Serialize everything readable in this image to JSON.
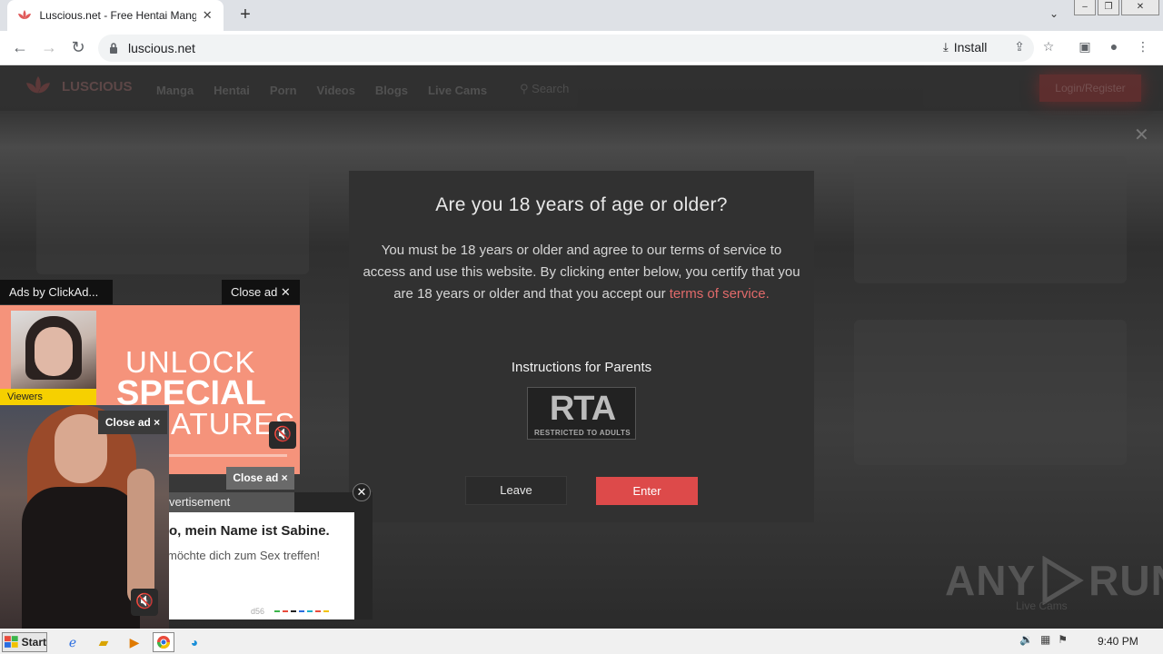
{
  "browser": {
    "tab_title": "Luscious.net - Free Hentai Manga, D",
    "url": "luscious.net",
    "install_label": "Install"
  },
  "site": {
    "logo": "LUSCIOUS",
    "nav": [
      "Manga",
      "Hentai",
      "Porn",
      "Videos",
      "Blogs",
      "Live Cams"
    ],
    "search_placeholder": "Search",
    "login_label": "Login/Register"
  },
  "modal": {
    "title": "Are you 18 years of age or older?",
    "body": "You must be 18 years or older and agree to our terms of service to access and use this website. By clicking enter below, you certify that you are 18 years or older and that you accept our",
    "link": "terms of service.",
    "parents": "Instructions for Parents",
    "rta_logo": "RTA",
    "rta_sub": "RESTRICTED TO ADULTS",
    "leave_label": "Leave",
    "enter_label": "Enter"
  },
  "ads": {
    "label": "Ads by ClickAd...",
    "close1": "Close ad ✕",
    "viewers": "Viewers",
    "unlock_line1": "UNLOCK",
    "unlock_line2": "SPECIAL",
    "unlock_line3": "ATURES",
    "close_small": "Close ad ×",
    "close2": "Close ad ×",
    "advertisement": "vertisement",
    "card_title": "o, mein Name ist Sabine.",
    "card_text": "möchte dich zum Sex treffen!",
    "card_foot": "d56"
  },
  "watermark": {
    "left": "ANY",
    "right": "RUN",
    "live": "Live Cams"
  },
  "taskbar": {
    "start": "Start",
    "clock": "9:40 PM"
  }
}
